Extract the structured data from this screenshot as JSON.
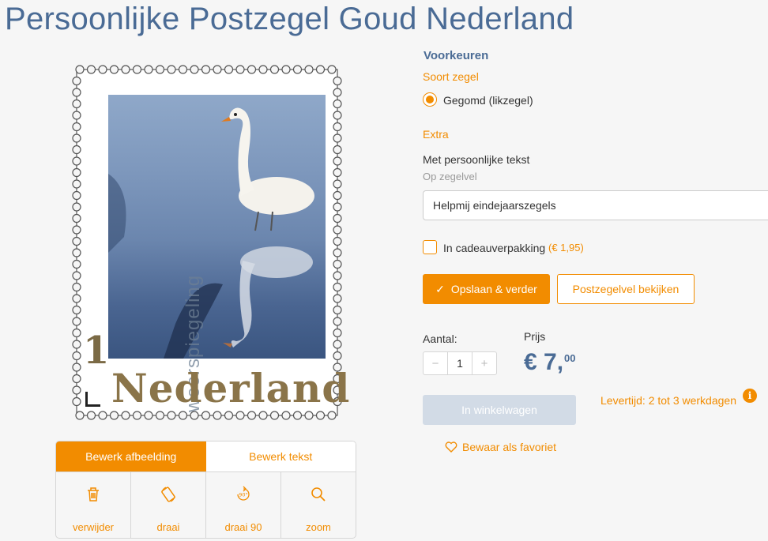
{
  "page": {
    "title": "Persoonlijke Postzegel Goud Nederland"
  },
  "stamp": {
    "watermark_text": "weerspiegeling",
    "denomination": "1",
    "country": "Nederland"
  },
  "edit_panel": {
    "tabs": [
      {
        "label": "Bewerk afbeelding",
        "active": true
      },
      {
        "label": "Bewerk tekst",
        "active": false
      }
    ],
    "tools": [
      {
        "label": "verwijder",
        "icon": "trash-icon"
      },
      {
        "label": "draai",
        "icon": "rotate-icon"
      },
      {
        "label": "draai 90",
        "icon": "rotate-90-icon"
      },
      {
        "label": "zoom",
        "icon": "zoom-icon"
      }
    ]
  },
  "options": {
    "heading": "Voorkeuren",
    "stamp_type_label": "Soort zegel",
    "stamp_type_option": "Gegomd (likzegel)",
    "extra_label": "Extra",
    "personal_text_label": "Met persoonlijke tekst",
    "personal_text_sub": "Op zegelvel",
    "personal_text_value": "Helpmij eindejaarszegels",
    "gift_label": "In cadeauverpakking",
    "gift_price": "(€ 1,95)",
    "save_button": "Opslaan & verder",
    "view_button": "Postzegelvel bekijken"
  },
  "purchase": {
    "quantity_label": "Aantal:",
    "quantity": "1",
    "price_label": "Prijs",
    "price_main": "€ 7,",
    "price_cents": "00",
    "cart_button": "In winkelwagen",
    "delivery": "Levertijd: 2 tot 3 werkdagen",
    "info_glyph": "i",
    "favorite": "Bewaar als favoriet"
  },
  "colors": {
    "accent": "#f28c00",
    "heading": "#4a6b95",
    "gold": "#8a7449"
  }
}
